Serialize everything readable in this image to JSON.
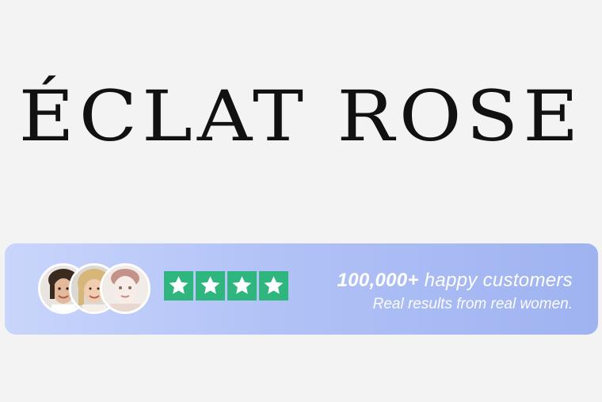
{
  "brand": {
    "name": "ÉCLAT ROSE"
  },
  "colors": {
    "background": "#f3f3f3",
    "banner_start": "#c9d5fb",
    "banner_end": "#9fb3f1",
    "star_green": "#2fb57e",
    "text_white": "#ffffff"
  },
  "banner": {
    "avatars": [
      {
        "name": "customer-avatar-1"
      },
      {
        "name": "customer-avatar-2"
      },
      {
        "name": "customer-avatar-3"
      }
    ],
    "rating": {
      "stars": 4,
      "icon": "star-icon"
    },
    "headline_number": "100,000+",
    "headline_text": " happy customers",
    "subline": "Real results from real women."
  }
}
